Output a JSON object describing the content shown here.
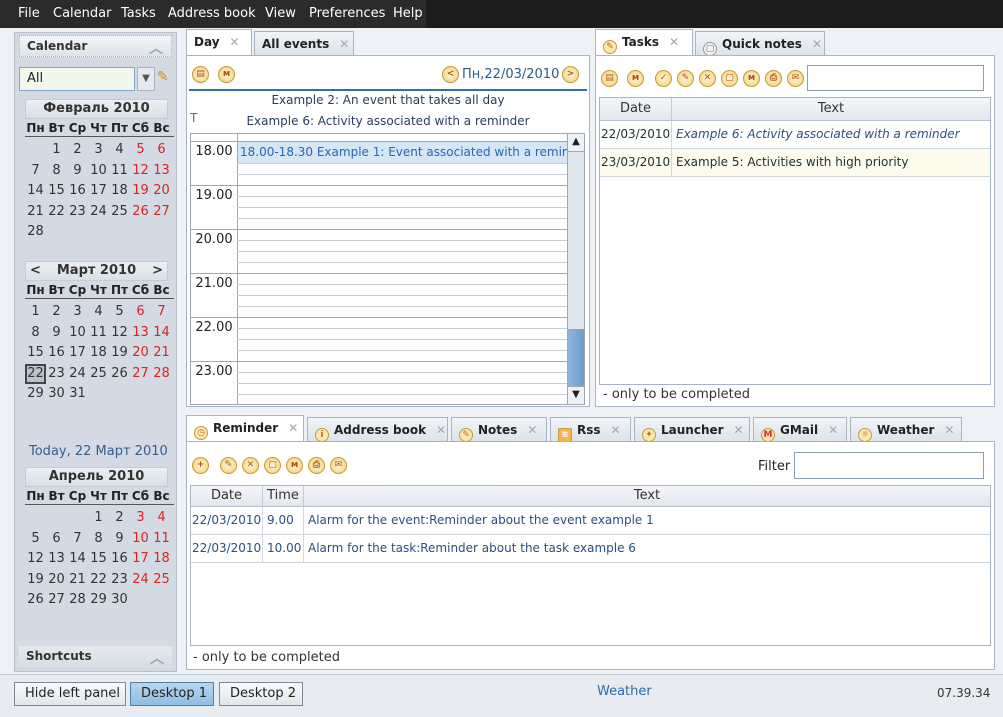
{
  "menu": [
    "File",
    "Calendar",
    "Tasks",
    "Address book",
    "View",
    "Preferences",
    "Help"
  ],
  "left": {
    "calendar_title": "Calendar",
    "combo_value": "All",
    "months": [
      {
        "name": "Февраль 2010",
        "dow": [
          "Пн",
          "Вт",
          "Ср",
          "Чт",
          "Пт",
          "Сб",
          "Вс"
        ],
        "days": [
          "",
          "1",
          "2",
          "3",
          "4",
          "5",
          "6",
          "7",
          "8",
          "9",
          "10",
          "11",
          "12",
          "13",
          "14",
          "15",
          "16",
          "17",
          "18",
          "19",
          "20",
          "21",
          "22",
          "23",
          "24",
          "25",
          "26",
          "27",
          "28"
        ]
      },
      {
        "name": "Март 2010",
        "dow": [
          "Пн",
          "Вт",
          "Ср",
          "Чт",
          "Пт",
          "Сб",
          "Вс"
        ],
        "days": [
          "1",
          "2",
          "3",
          "4",
          "5",
          "6",
          "7",
          "8",
          "9",
          "10",
          "11",
          "12",
          "13",
          "14",
          "15",
          "16",
          "17",
          "18",
          "19",
          "20",
          "21",
          "22",
          "23",
          "24",
          "25",
          "26",
          "27",
          "28",
          "29",
          "30",
          "31"
        ]
      },
      {
        "name": "Апрель 2010",
        "dow": [
          "Пн",
          "Вт",
          "Ср",
          "Чт",
          "Пт",
          "Сб",
          "Вс"
        ],
        "days": [
          "",
          "",
          "",
          "1",
          "2",
          "3",
          "4",
          "5",
          "6",
          "7",
          "8",
          "9",
          "10",
          "11",
          "12",
          "13",
          "14",
          "15",
          "16",
          "17",
          "18",
          "19",
          "20",
          "21",
          "22",
          "23",
          "24",
          "25",
          "26",
          "27",
          "28",
          "29",
          "30"
        ]
      }
    ],
    "today_label": "Today, 22 Март 2010",
    "shortcuts_title": "Shortcuts"
  },
  "day": {
    "tabs": [
      {
        "label": "Day"
      },
      {
        "label": "All events"
      }
    ],
    "date_label": "Пн,22/03/2010",
    "allday_events": [
      "Example 2: An event that takes all day",
      "Example 6: Activity associated with a reminder"
    ],
    "allday_marker": "T",
    "hours": [
      "18.00",
      "19.00",
      "20.00",
      "21.00",
      "22.00",
      "23.00"
    ],
    "event": "18.00-18.30 Example 1: Event associated with a reminder"
  },
  "tasks": {
    "tabs": [
      {
        "label": "Tasks"
      },
      {
        "label": "Quick notes"
      }
    ],
    "columns": [
      "Date",
      "Text"
    ],
    "rows": [
      {
        "date": "22/03/2010",
        "text": "Example 6: Activity associated with a reminder"
      },
      {
        "date": "23/03/2010",
        "text": "Example 5: Activities with high priority"
      }
    ],
    "footer": "- only to be completed"
  },
  "reminder": {
    "tabs": [
      {
        "label": "Reminder"
      },
      {
        "label": "Address book"
      },
      {
        "label": "Notes"
      },
      {
        "label": "Rss"
      },
      {
        "label": "Launcher"
      },
      {
        "label": "GMail"
      },
      {
        "label": "Weather"
      }
    ],
    "filter_label": "Filter",
    "columns": [
      "Date",
      "Time",
      "Text"
    ],
    "rows": [
      {
        "date": "22/03/2010",
        "time": "9.00",
        "text": "Alarm for the event:Reminder about the event example 1"
      },
      {
        "date": "22/03/2010",
        "time": "10.00",
        "text": "Alarm for the task:Reminder about the task example 6"
      }
    ],
    "footer": "- only to be completed"
  },
  "bottom": {
    "hide_left": "Hide left panel",
    "desktops": [
      "Desktop 1",
      "Desktop 2"
    ],
    "weather": "Weather",
    "clock": "07.39.34"
  }
}
